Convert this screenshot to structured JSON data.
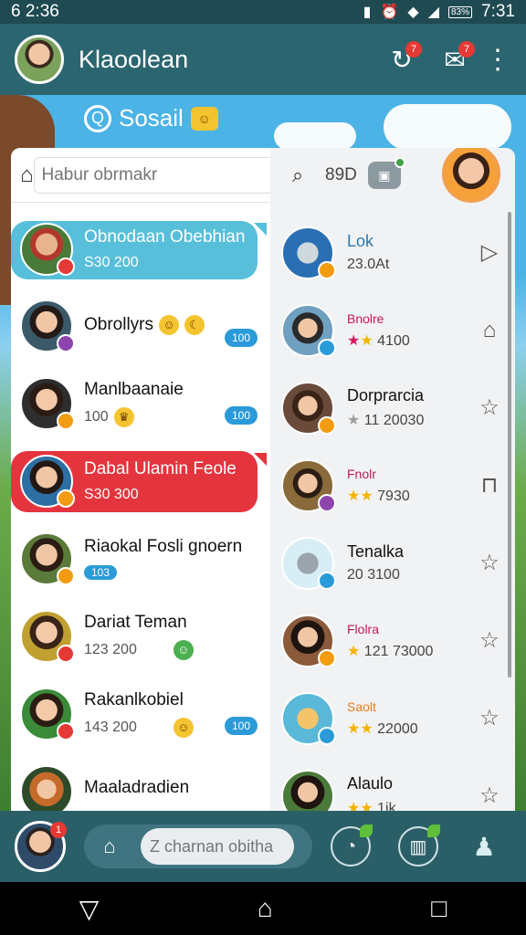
{
  "status_bar": {
    "time_left": "6 2:36",
    "battery": "83%",
    "time_right": "7:31"
  },
  "app_bar": {
    "title": "Klaoolean",
    "icons": [
      "refresh-icon",
      "chat-icon",
      "more-icon"
    ],
    "badge1": "7",
    "badge2": "7"
  },
  "social": {
    "title": "Sosail"
  },
  "left_panel": {
    "search_placeholder": "Habur obrmakr",
    "chats": [
      {
        "name": "Obnodaan Obebhian",
        "sub": "S30 200",
        "style": "blue"
      },
      {
        "name": "Obrollyrs",
        "badge": "100"
      },
      {
        "name": "Manlbaanaie",
        "sub": "100",
        "badge": "100"
      },
      {
        "name": "Dabal Ulamin Feole",
        "sub": "S30 300",
        "style": "red"
      },
      {
        "name": "Riaokal Fosli gnoern",
        "tag": "103"
      },
      {
        "name": "Dariat Teman",
        "sub": "123 200"
      },
      {
        "name": "Rakanlkobiel",
        "sub": "143 200",
        "badge": "100"
      },
      {
        "name": "Maaladradien",
        "sub": ""
      }
    ]
  },
  "right_panel": {
    "count": "89D",
    "items": [
      {
        "name": "Lok",
        "sub": "23.0At",
        "action": "share-icon"
      },
      {
        "name": "Bnolre",
        "sub": "4100",
        "action": "home-outline-icon"
      },
      {
        "name": "Dorprarcia",
        "sub": "11 20030",
        "action": "star-outline-icon"
      },
      {
        "name": "Fnolr",
        "sub": "7930",
        "action": "bag-icon"
      },
      {
        "name": "Tenalka",
        "sub": "20 3100",
        "action": "star-outline-icon"
      },
      {
        "name": "Flolra",
        "sub": "121 73000",
        "action": "star-outline-icon"
      },
      {
        "name": "Saolt",
        "sub": "22000",
        "action": "star-outline-icon"
      },
      {
        "name": "Alaulo",
        "sub": "1ik",
        "action": "star-outline-icon"
      }
    ]
  },
  "bottom_bar": {
    "compose_placeholder": "Z charnan obitha",
    "badge": "1"
  }
}
